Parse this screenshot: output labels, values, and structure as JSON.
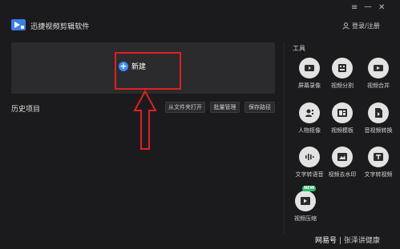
{
  "app": {
    "name": "迅捷视频剪辑软件"
  },
  "window": {
    "menu_glyph": "≡",
    "minimize_glyph": "—",
    "close_glyph": "✕"
  },
  "header": {
    "login_label": "登录/注册"
  },
  "new_project": {
    "label": "新建",
    "plus_glyph": "+"
  },
  "history": {
    "title": "历史项目",
    "buttons": [
      "从文件夹打开",
      "批量管理",
      "保存路径"
    ]
  },
  "tools": {
    "title": "工具",
    "items": [
      {
        "label": "屏幕录像",
        "icon": "camera-icon"
      },
      {
        "label": "视频分割",
        "icon": "film-split-icon"
      },
      {
        "label": "视频合并",
        "icon": "video-merge-icon"
      },
      {
        "label": "人物抠像",
        "icon": "person-cutout-icon"
      },
      {
        "label": "视频模板",
        "icon": "template-icon"
      },
      {
        "label": "音视频转换",
        "icon": "convert-icon"
      },
      {
        "label": "文字转语音",
        "icon": "text-to-speech-icon"
      },
      {
        "label": "视频去水印",
        "icon": "remove-watermark-icon"
      },
      {
        "label": "文字转视频",
        "icon": "text-to-video-icon"
      },
      {
        "label": "视频压缩",
        "icon": "compress-icon",
        "badge": "NEW"
      }
    ]
  },
  "watermark": {
    "logo": "网易号",
    "separator": "|",
    "author": "张泽讲健康"
  },
  "colors": {
    "background": "#1b1b1d",
    "panel": "#2b2b2e",
    "accent": "#3d8af7",
    "highlight": "#e02020",
    "badge": "#2fb86a"
  }
}
